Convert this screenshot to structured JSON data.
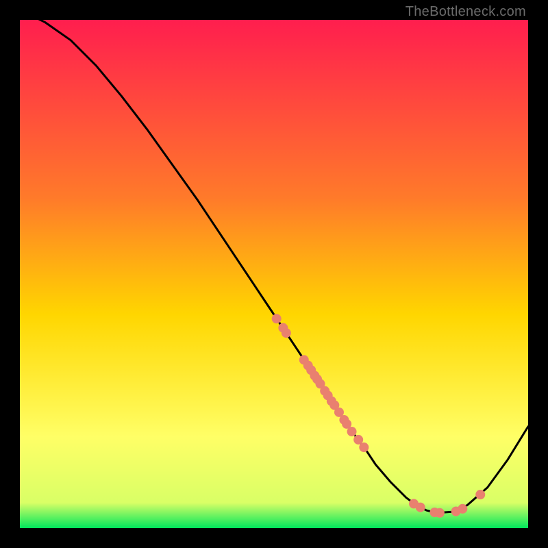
{
  "watermark": "TheBottleneck.com",
  "chart_data": {
    "type": "line",
    "title": "",
    "xlabel": "",
    "ylabel": "",
    "xlim": [
      0,
      100
    ],
    "ylim": [
      0,
      100
    ],
    "grid": false,
    "legend": false,
    "series": [
      {
        "name": "curve",
        "x": [
          0,
          5,
          10,
          15,
          20,
          25,
          30,
          35,
          40,
          45,
          50,
          55,
          60,
          62,
          65,
          68,
          70,
          73,
          76,
          78,
          80,
          82,
          85,
          88,
          92,
          96,
          100
        ],
        "y": [
          102,
          99.5,
          96,
          91,
          85,
          78.5,
          71.5,
          64.5,
          57,
          49.5,
          42,
          34.5,
          27,
          24,
          19.5,
          15.5,
          12.5,
          9,
          6,
          4.5,
          3.5,
          3,
          3.2,
          4.5,
          8,
          13.5,
          20
        ]
      }
    ],
    "scatter_points": [
      {
        "x": 50.5,
        "y": 41.2
      },
      {
        "x": 51.8,
        "y": 39.4
      },
      {
        "x": 52.4,
        "y": 38.4
      },
      {
        "x": 55.9,
        "y": 33.1
      },
      {
        "x": 56.7,
        "y": 32.0
      },
      {
        "x": 57.3,
        "y": 31.1
      },
      {
        "x": 58.0,
        "y": 30.0
      },
      {
        "x": 58.5,
        "y": 29.3
      },
      {
        "x": 59.1,
        "y": 28.4
      },
      {
        "x": 60.0,
        "y": 27.0
      },
      {
        "x": 60.6,
        "y": 26.1
      },
      {
        "x": 61.3,
        "y": 25.0
      },
      {
        "x": 61.9,
        "y": 24.2
      },
      {
        "x": 62.8,
        "y": 22.8
      },
      {
        "x": 63.8,
        "y": 21.3
      },
      {
        "x": 64.3,
        "y": 20.5
      },
      {
        "x": 65.3,
        "y": 19.0
      },
      {
        "x": 66.6,
        "y": 17.4
      },
      {
        "x": 67.7,
        "y": 15.9
      },
      {
        "x": 77.5,
        "y": 4.8
      },
      {
        "x": 78.8,
        "y": 4.1
      },
      {
        "x": 81.6,
        "y": 3.1
      },
      {
        "x": 82.6,
        "y": 3.0
      },
      {
        "x": 85.8,
        "y": 3.3
      },
      {
        "x": 87.1,
        "y": 3.8
      },
      {
        "x": 90.6,
        "y": 6.6
      }
    ],
    "colors": {
      "gradient_top": "#ff1e4e",
      "gradient_mid1": "#ff7a2a",
      "gradient_mid2": "#ffd600",
      "gradient_mid3": "#ffff66",
      "gradient_bottom": "#00e65c",
      "curve": "#000000",
      "points": "#e9806f"
    }
  }
}
